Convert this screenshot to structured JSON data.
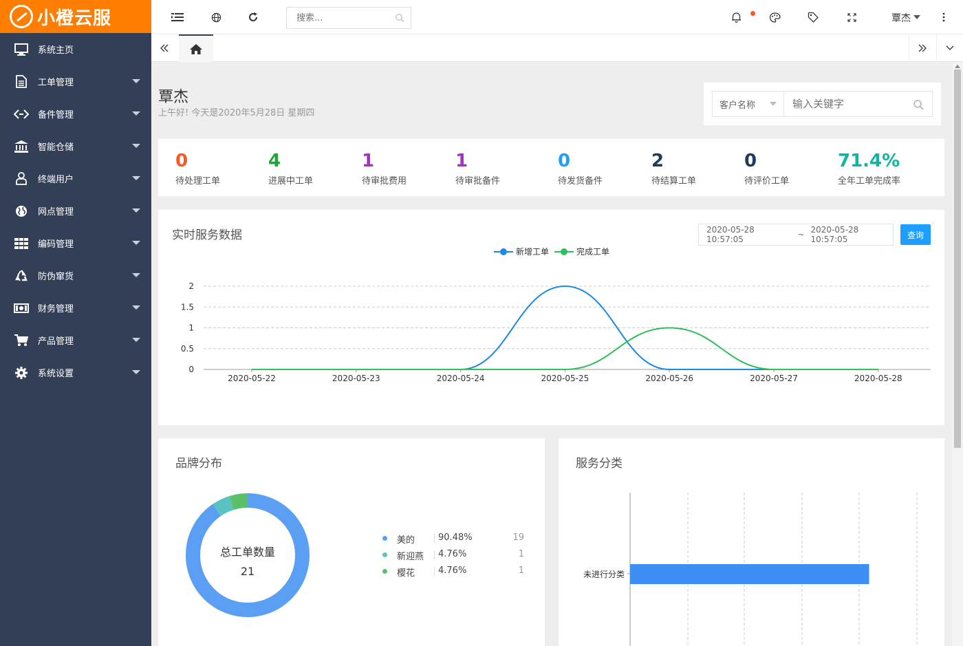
{
  "app": {
    "logo_text": "小橙云服"
  },
  "sidebar": {
    "items": [
      {
        "label": "系统主页",
        "icon": "monitor-icon",
        "expandable": false
      },
      {
        "label": "工单管理",
        "icon": "document-icon",
        "expandable": true
      },
      {
        "label": "备件管理",
        "icon": "code-icon",
        "expandable": true
      },
      {
        "label": "智能仓储",
        "icon": "bank-icon",
        "expandable": true
      },
      {
        "label": "终端用户",
        "icon": "user-icon",
        "expandable": true
      },
      {
        "label": "网点管理",
        "icon": "globe-icon",
        "expandable": true
      },
      {
        "label": "编码管理",
        "icon": "grid-icon",
        "expandable": true
      },
      {
        "label": "防伪窜货",
        "icon": "recycle-icon",
        "expandable": true
      },
      {
        "label": "财务管理",
        "icon": "money-icon",
        "expandable": true
      },
      {
        "label": "产品管理",
        "icon": "cart-icon",
        "expandable": true
      },
      {
        "label": "系统设置",
        "icon": "gear-icon",
        "expandable": true
      }
    ]
  },
  "topbar": {
    "search_placeholder": "搜索...",
    "user_name": "覃杰"
  },
  "greeting": {
    "name": "覃杰",
    "subtitle": "上午好!  今天是2020年5月28日 星期四"
  },
  "filter": {
    "select_label": "客户名称",
    "input_placeholder": "输入关键字"
  },
  "stats": [
    {
      "value": "0",
      "label": "待处理工单",
      "color": "#ff5722"
    },
    {
      "value": "4",
      "label": "进展中工单",
      "color": "#1aa832"
    },
    {
      "value": "1",
      "label": "待审批费用",
      "color": "#a233c6"
    },
    {
      "value": "1",
      "label": "待审批备件",
      "color": "#a233c6"
    },
    {
      "value": "0",
      "label": "待发货备件",
      "color": "#1e9fff"
    },
    {
      "value": "2",
      "label": "待结算工单",
      "color": "#1f3a5a"
    },
    {
      "value": "0",
      "label": "待评价工单",
      "color": "#1f3a5a"
    },
    {
      "value": "71.4%",
      "label": "全年工单完成率",
      "color": "#0cb5a4"
    }
  ],
  "realtime": {
    "title": "实时服务数据",
    "date_start": "2020-05-28 10:57:05",
    "date_sep": "~",
    "date_end": "2020-05-28 10:57:05",
    "query_label": "查询"
  },
  "brand": {
    "title": "品牌分布",
    "center_label": "总工单数量",
    "center_value": "21",
    "items": [
      {
        "name": "美的",
        "percent": "90.48%",
        "count": "19",
        "color": "#5b9ff5"
      },
      {
        "name": "新迎燕",
        "percent": "4.76%",
        "count": "1",
        "color": "#5bc2c4"
      },
      {
        "name": "樱花",
        "percent": "4.76%",
        "count": "1",
        "color": "#5cbf6a"
      }
    ]
  },
  "service": {
    "title": "服务分类"
  },
  "chart_data": [
    {
      "type": "line",
      "x": [
        "2020-05-22",
        "2020-05-23",
        "2020-05-24",
        "2020-05-25",
        "2020-05-26",
        "2020-05-27",
        "2020-05-28"
      ],
      "series": [
        {
          "name": "新增工单",
          "values": [
            0,
            0,
            0,
            2,
            0,
            0,
            0
          ],
          "color": "#1e88e5"
        },
        {
          "name": "完成工单",
          "values": [
            0,
            0,
            0,
            0,
            1,
            0,
            0
          ],
          "color": "#2ebf5a"
        }
      ],
      "yticks": [
        0,
        0.5,
        1,
        1.5,
        2
      ],
      "ylim": [
        0,
        2
      ],
      "smooth": true,
      "grid": "horizontal-dashed",
      "legend": "top-center"
    },
    {
      "type": "pie",
      "variant": "donut",
      "categories": [
        "美的",
        "新迎燕",
        "樱花"
      ],
      "values": [
        19,
        1,
        1
      ]
    },
    {
      "type": "bar",
      "orientation": "horizontal",
      "categories": [
        "未进行分类"
      ],
      "values": [
        1
      ],
      "color": "#3d8ff3",
      "grid": "vertical-dashed"
    }
  ]
}
